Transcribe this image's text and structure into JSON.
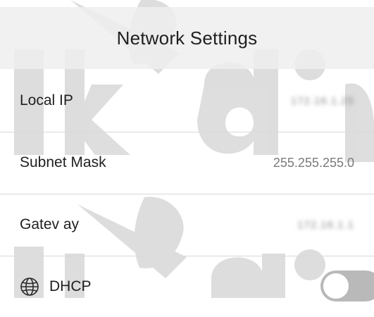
{
  "header": {
    "title": "Network Settings"
  },
  "rows": [
    {
      "label": "Local IP",
      "value": "172.16.1.25"
    },
    {
      "label": "Subnet Mask",
      "value": "255.255.255.0"
    },
    {
      "label": "Gatev ay",
      "value": "172.16.1.1"
    },
    {
      "label": "DHCP",
      "icon": "globe-icon",
      "toggle_state": "off"
    }
  ],
  "watermark": {
    "text": "lik dig"
  },
  "colors": {
    "header_bg": "#eeeeee",
    "divider": "#d9d9d9",
    "toggle_off": "#b9b9b9",
    "value_text": "#7a7a7a"
  }
}
